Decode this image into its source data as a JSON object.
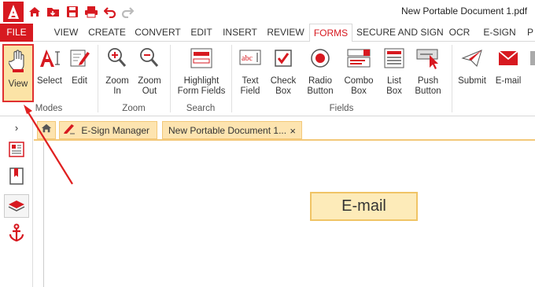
{
  "window": {
    "title": "New Portable Document 1.pdf"
  },
  "menu_tabs": [
    "FILE",
    "VIEW",
    "CREATE",
    "CONVERT",
    "EDIT",
    "INSERT",
    "REVIEW",
    "FORMS",
    "SECURE AND SIGN",
    "OCR",
    "E-SIGN",
    "P"
  ],
  "active_tab": "FORMS",
  "ribbon": {
    "modes": {
      "label": "Modes",
      "view": "View",
      "select": "Select",
      "edit": "Edit"
    },
    "zoom": {
      "label": "Zoom",
      "zoom_in": [
        "Zoom",
        "In"
      ],
      "zoom_out": [
        "Zoom",
        "Out"
      ]
    },
    "search": {
      "label": "Search",
      "highlight": [
        "Highlight",
        "Form Fields"
      ]
    },
    "fields": {
      "label": "Fields",
      "text_field": [
        "Text",
        "Field"
      ],
      "check_box": [
        "Check",
        "Box"
      ],
      "radio_button": [
        "Radio",
        "Button"
      ],
      "combo_box": [
        "Combo",
        "Box"
      ],
      "list_box": [
        "List",
        "Box"
      ],
      "push_button": [
        "Push",
        "Button"
      ]
    },
    "actions": {
      "submit": "Submit",
      "email": "E-mail"
    }
  },
  "doc_tabs": {
    "esign_manager": "E-Sign Manager",
    "document": "New Portable Document 1...",
    "close": "×"
  },
  "page": {
    "email_field": "E-mail"
  },
  "colors": {
    "brand": "#d71920",
    "highlight": "#fbe3a6",
    "tab_accent": "#f3c879"
  }
}
